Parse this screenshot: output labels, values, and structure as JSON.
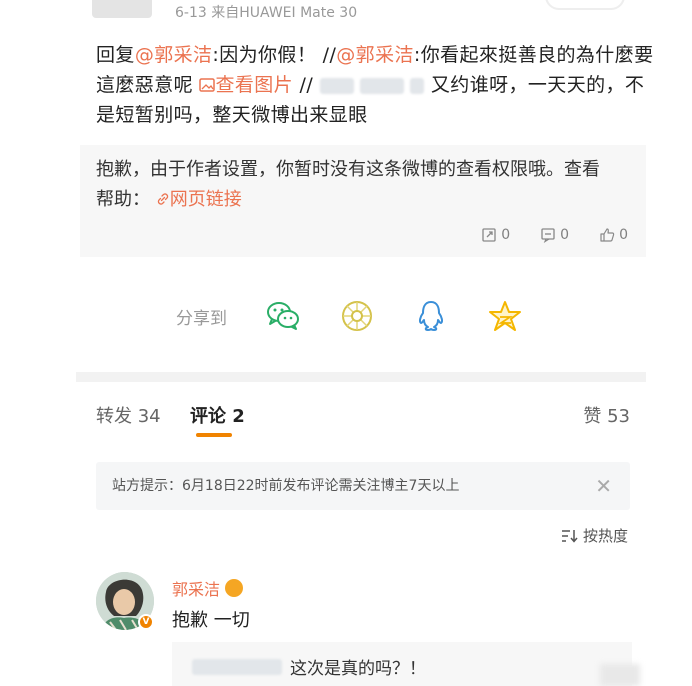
{
  "top": {
    "date_prefix": "6-13",
    "meta_text": "来自HUAWEI Mate 30"
  },
  "post": {
    "reply_prefix": "回复",
    "mention1": "@郭采洁",
    "text1": ":因为你假！ //",
    "mention2": "@郭采洁",
    "text2": ":你看起來挺善良的為什麼要這麼惡意呢",
    "image_link": "查看图片",
    "text3": " // ",
    "text4": " 又约谁呀，一天天的，不是短暂别吗，整天微博出来显眼"
  },
  "quote": {
    "line": "抱歉，由于作者设置，你暂时没有这条微博的查看权限哦。查看帮助：",
    "help_link": "网页链接",
    "repost_count": "0",
    "comment_count": "0",
    "like_count": "0"
  },
  "share": {
    "label": "分享到",
    "icons": [
      "wechat-icon",
      "moments-icon",
      "qq-icon",
      "qzone-icon"
    ]
  },
  "tabs": {
    "repost_label": "转发",
    "repost_count": "34",
    "comment_label": "评论",
    "comment_count": "2",
    "likes_label": "赞",
    "likes_count": "53"
  },
  "notice": {
    "text": "站方提示：6月18日22时前发布评论需关注博主7天以上"
  },
  "sort": {
    "label": "按热度"
  },
  "comment": {
    "username": "郭采洁",
    "text": "抱歉 一切",
    "reply_text": "这次是真的吗？！"
  },
  "colors": {
    "accent": "#eb7350",
    "tab_underline": "#f08300",
    "wechat": "#2aae67",
    "moments": "#d4c24a",
    "qq": "#3a8fd8",
    "qzone": "#f5b700"
  }
}
